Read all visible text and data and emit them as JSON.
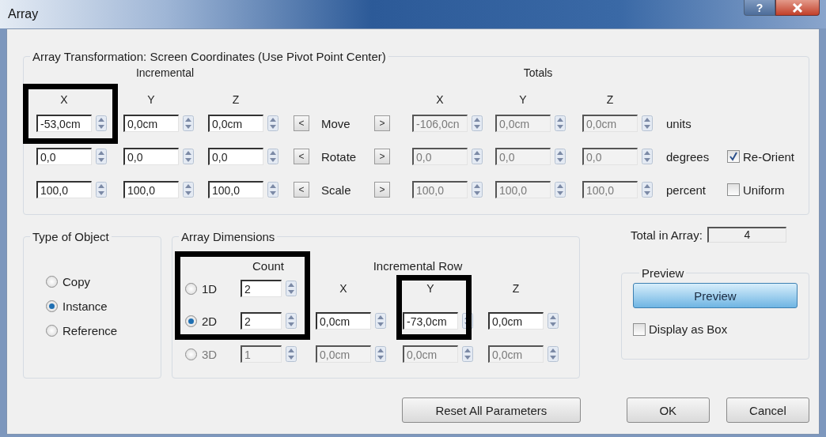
{
  "window": {
    "title": "Array",
    "help_button": "?"
  },
  "transformation": {
    "title": "Array Transformation: Screen Coordinates (Use Pivot Point Center)",
    "incremental_label": "Incremental",
    "totals_label": "Totals",
    "incremental_axes": [
      "X",
      "Y",
      "Z"
    ],
    "totals_axes": [
      "X",
      "Y",
      "Z"
    ],
    "totals_disabled": true,
    "rows": [
      {
        "incremental": [
          "-53,0cm",
          "0,0cm",
          "0,0cm"
        ],
        "left_button": "<",
        "label": "Move",
        "right_button": ">",
        "totals": [
          "-106,0cn",
          "0,0cm",
          "0,0cm"
        ],
        "unit": "units"
      },
      {
        "incremental": [
          "0,0",
          "0,0",
          "0,0"
        ],
        "left_button": "<",
        "label": "Rotate",
        "right_button": ">",
        "totals": [
          "0,0",
          "0,0",
          "0,0"
        ],
        "unit": "degrees",
        "option": {
          "label": "Re-Orient",
          "checked": true
        }
      },
      {
        "incremental": [
          "100,0",
          "100,0",
          "100,0"
        ],
        "left_button": "<",
        "label": "Scale",
        "right_button": ">",
        "totals": [
          "100,0",
          "100,0",
          "100,0"
        ],
        "unit": "percent",
        "option": {
          "label": "Uniform",
          "checked": false
        }
      }
    ]
  },
  "type_of_object": {
    "title": "Type of Object",
    "options": [
      {
        "label": "Copy",
        "selected": false
      },
      {
        "label": "Instance",
        "selected": true
      },
      {
        "label": "Reference",
        "selected": false
      }
    ]
  },
  "array_dimensions": {
    "title": "Array Dimensions",
    "count_label": "Count",
    "incremental_row_label": "Incremental Row",
    "axes": [
      "X",
      "Y",
      "Z"
    ],
    "rows": [
      {
        "label": "1D",
        "selected": false,
        "count": "2",
        "disabled": false
      },
      {
        "label": "2D",
        "selected": true,
        "count": "2",
        "offsets": [
          "0,0cm",
          "-73,0cm",
          "0,0cm"
        ],
        "disabled": false
      },
      {
        "label": "3D",
        "selected": false,
        "count": "1",
        "offsets": [
          "0,0cm",
          "0,0cm",
          "0,0cm"
        ],
        "disabled": true
      }
    ]
  },
  "total_in_array": {
    "label": "Total in Array:",
    "value": "4"
  },
  "preview": {
    "title": "Preview",
    "button": "Preview",
    "display_as_box": {
      "label": "Display as Box",
      "checked": false
    }
  },
  "buttons": [
    "Reset All Parameters",
    "OK",
    "Cancel"
  ]
}
